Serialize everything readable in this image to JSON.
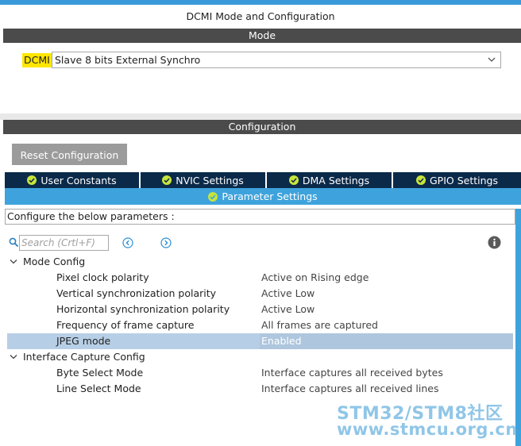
{
  "header": {
    "title": "DCMI Mode and Configuration"
  },
  "mode": {
    "section_label": "Mode",
    "peripheral_label": "DCMI",
    "selected_value": "Slave 8 bits External Synchro"
  },
  "configuration": {
    "section_label": "Configuration",
    "reset_label": "Reset Configuration",
    "tabs": [
      {
        "label": "User Constants"
      },
      {
        "label": "NVIC Settings"
      },
      {
        "label": "DMA Settings"
      },
      {
        "label": "GPIO Settings"
      }
    ],
    "active_tab": {
      "label": "Parameter Settings"
    },
    "configure_hint": "Configure the below parameters :",
    "search": {
      "placeholder": "Search (Crtl+F)"
    },
    "groups": [
      {
        "label": "Mode Config",
        "params": [
          {
            "name": "Pixel clock polarity",
            "value": "Active on Rising edge"
          },
          {
            "name": "Vertical synchronization polarity",
            "value": "Active Low"
          },
          {
            "name": "Horizontal synchronization polarity",
            "value": "Active Low"
          },
          {
            "name": "Frequency of frame capture",
            "value": "All frames are captured"
          },
          {
            "name": "JPEG mode",
            "value": "Enabled"
          }
        ]
      },
      {
        "label": "Interface Capture Config",
        "params": [
          {
            "name": "Byte Select Mode",
            "value": "Interface captures all received bytes"
          },
          {
            "name": "Line Select Mode",
            "value": "Interface captures all received lines"
          }
        ]
      }
    ]
  },
  "watermark": {
    "line1": "STM32/STM8社区",
    "line2": "www.stmcu.org.cn"
  },
  "colors": {
    "section_bar": "#4b4b4b",
    "tab_dark": "#0b2a4a",
    "tab_active": "#3ea3dc",
    "highlight_yellow": "#ffe600",
    "check_green": "#c8e43c",
    "selected_row": "#b7cfe6"
  }
}
